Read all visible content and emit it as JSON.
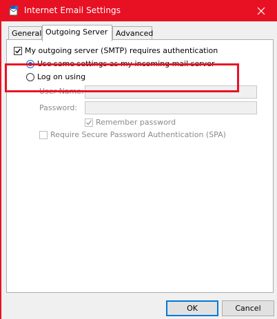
{
  "window": {
    "title": "Internet Email Settings",
    "close_glyph": "✕",
    "title_color": "#e81123"
  },
  "tabs": [
    {
      "label": "General",
      "active": false
    },
    {
      "label": "Outgoing Server",
      "active": true
    },
    {
      "label": "Advanced",
      "active": false
    }
  ],
  "outgoing": {
    "smtp_auth_label": "My outgoing server (SMTP) requires authentication",
    "smtp_auth_checked": true,
    "use_same_label": "Use same settings as my incoming mail server",
    "use_same_selected": true,
    "log_on_label": "Log on using",
    "log_on_selected": false,
    "username_label": "User Name:",
    "username_value": "",
    "password_label": "Password:",
    "password_value": "",
    "remember_label": "Remember password",
    "remember_checked": true,
    "spa_label": "Require Secure Password Authentication (SPA)",
    "spa_checked": false
  },
  "buttons": {
    "ok_label": "OK",
    "cancel_label": "Cancel"
  },
  "icons": [
    "envelope-icon",
    "close-icon",
    "checkmark-icon"
  ]
}
